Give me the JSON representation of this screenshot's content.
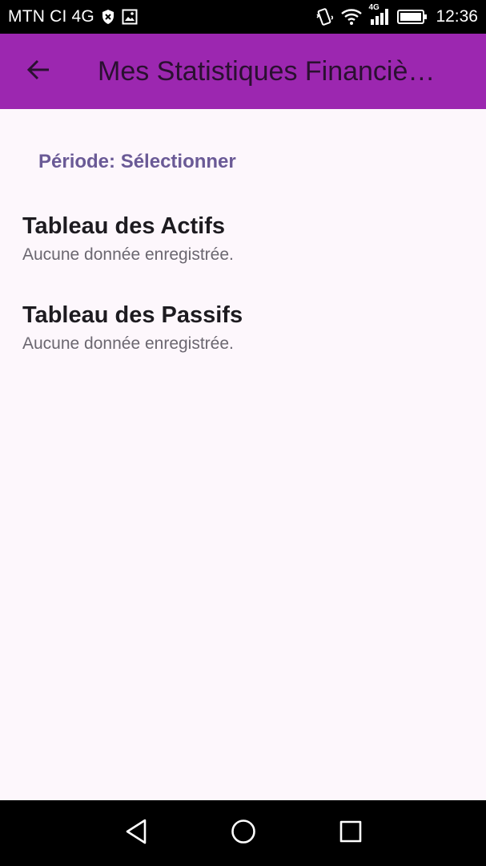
{
  "status_bar": {
    "carrier": "MTN CI 4G",
    "network_label": "4G",
    "time": "12:36",
    "icons": [
      "shield-icon",
      "image-icon",
      "vibrate-icon",
      "wifi-icon",
      "signal-icon",
      "battery-icon"
    ]
  },
  "app_bar": {
    "title": "Mes Statistiques Financiè…",
    "background": "#9c27b0",
    "back_icon": "arrow-left-icon"
  },
  "content": {
    "period_label": "Période: Sélectionner",
    "sections": [
      {
        "title": "Tableau des Actifs",
        "empty_text": "Aucune donnée enregistrée."
      },
      {
        "title": "Tableau des Passifs",
        "empty_text": "Aucune donnée enregistrée."
      }
    ]
  },
  "nav_bar": {
    "icons": [
      "back-triangle-icon",
      "home-circle-icon",
      "recents-square-icon"
    ]
  }
}
